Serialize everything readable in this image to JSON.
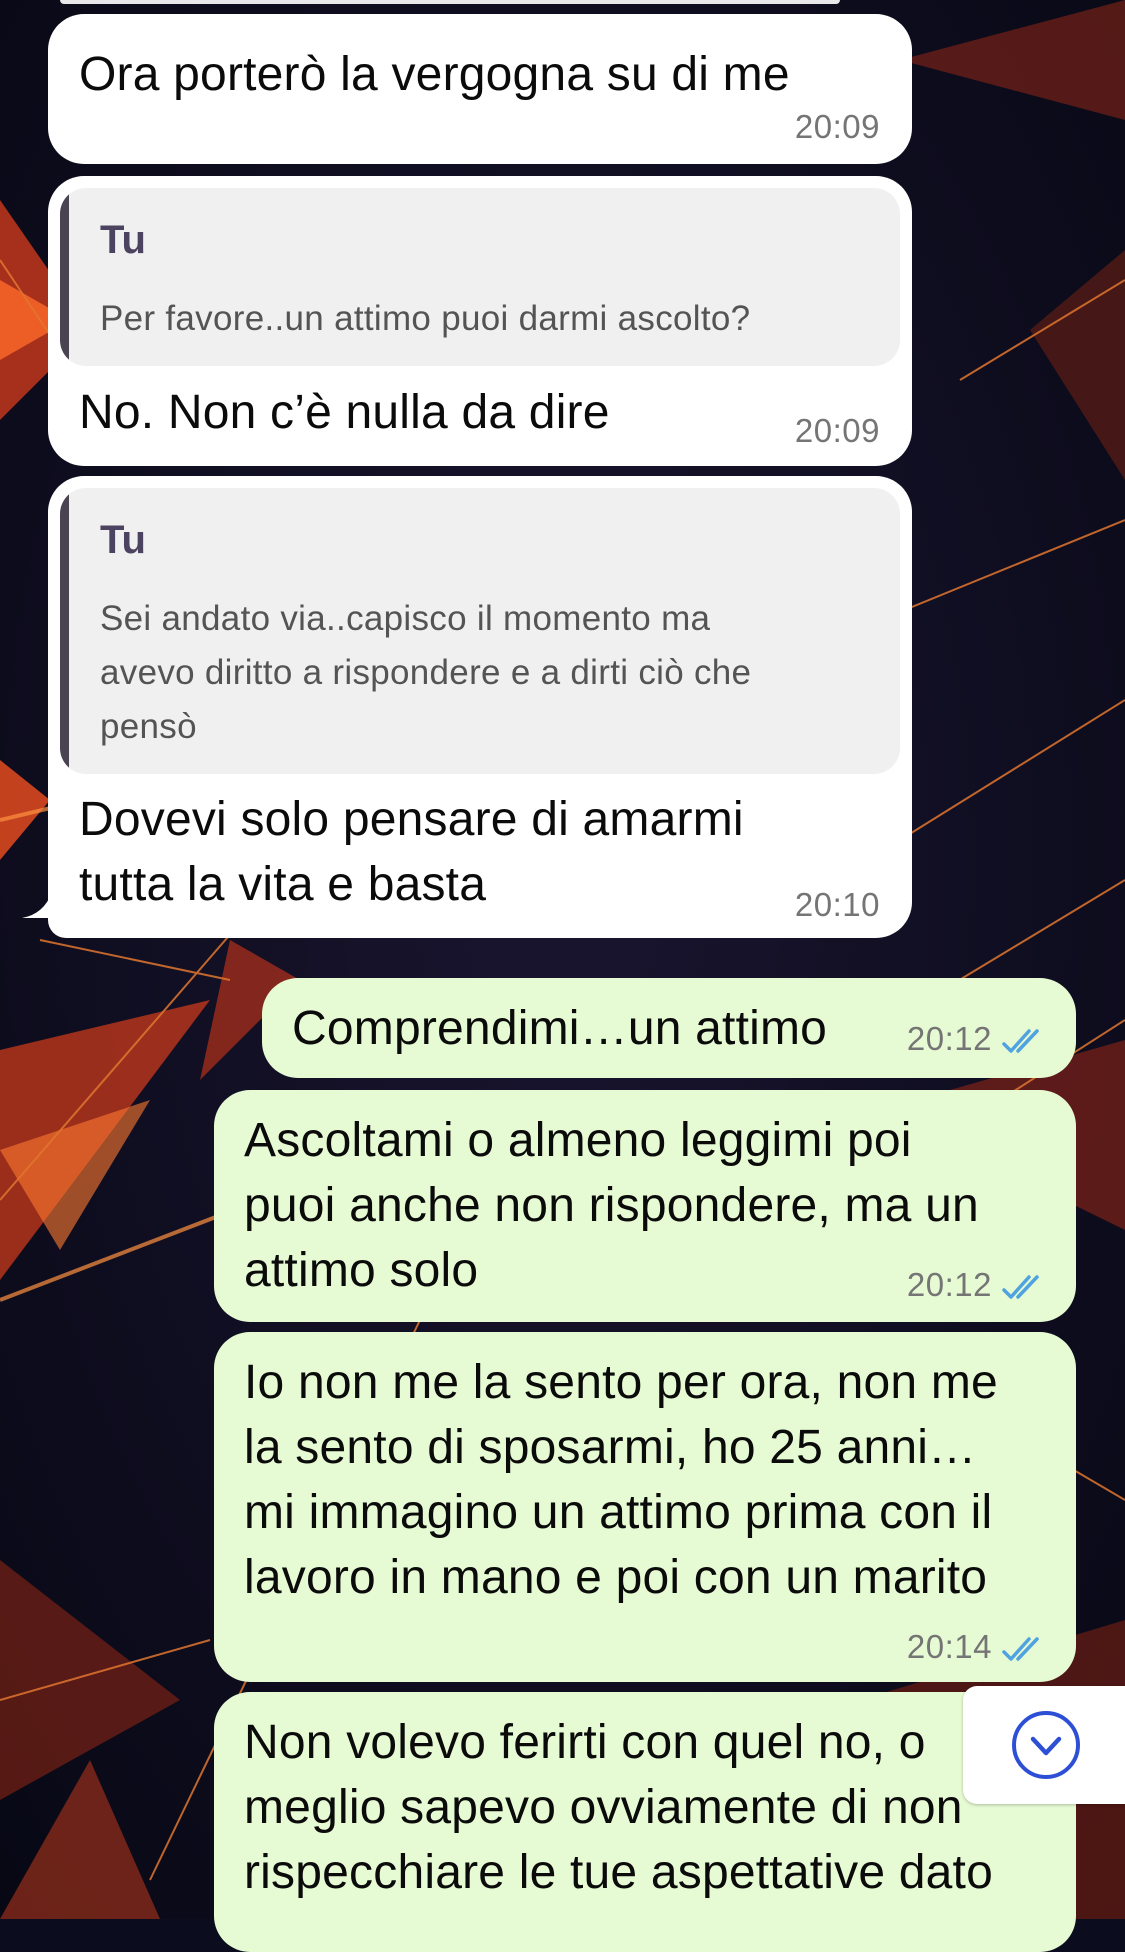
{
  "messages": [
    {
      "direction": "in",
      "text": "Ora porterò la vergogna su di me",
      "time": "20:09"
    },
    {
      "direction": "in",
      "quote": {
        "author": "Tu",
        "text": "Per favore..un attimo puoi darmi ascolto?"
      },
      "text": "No. Non c’è nulla da dire",
      "time": "20:09"
    },
    {
      "direction": "in",
      "quote": {
        "author": "Tu",
        "lines": [
          "Sei andato via..capisco il momento ma",
          "avevo diritto a rispondere e a dirti ciò che",
          "pensò"
        ]
      },
      "lines": [
        "Dovevi solo pensare di amarmi",
        "tutta la vita e basta"
      ],
      "time": "20:10"
    },
    {
      "direction": "out",
      "text": "Comprendimi…un attimo",
      "time": "20:12",
      "status": "read"
    },
    {
      "direction": "out",
      "lines": [
        "Ascoltami o almeno leggimi poi",
        "puoi anche non rispondere, ma un",
        "attimo solo"
      ],
      "time": "20:12",
      "status": "read"
    },
    {
      "direction": "out",
      "lines": [
        "Io non me la sento per ora, non me",
        "la sento di sposarmi, ho 25 anni…",
        "mi immagino un attimo prima con il",
        "lavoro in mano e poi con un marito"
      ],
      "time": "20:14",
      "status": "read"
    },
    {
      "direction": "out",
      "lines": [
        "Non volevo ferirti con quel no, o",
        "meglio sapevo ovviamente di non",
        "rispecchiare le tue aspettative dato"
      ]
    }
  ],
  "scroll_button": {
    "icon": "chevron-down-circle-icon"
  },
  "colors": {
    "incoming": "#ffffff",
    "outgoing": "#e6fbd3",
    "read_ticks": "#4fa3e0",
    "scroll_icon": "#2d4fd6"
  }
}
